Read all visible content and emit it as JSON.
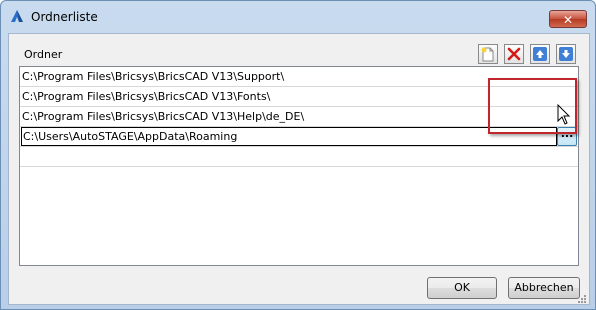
{
  "window": {
    "title": "Ordnerliste",
    "close_label": "✕"
  },
  "list": {
    "header": "Ordner",
    "rows": [
      "C:\\Program Files\\Bricsys\\BricsCAD V13\\Support\\",
      "C:\\Program Files\\Bricsys\\BricsCAD V13\\Fonts\\",
      "C:\\Program Files\\Bricsys\\BricsCAD V13\\Help\\de_DE\\"
    ],
    "edit_value": "C:\\Users\\AutoSTAGE\\AppData\\Roaming",
    "browse_label": "..."
  },
  "toolbar": {
    "icons": [
      "new-folder-icon",
      "delete-icon",
      "move-up-icon",
      "move-down-icon"
    ]
  },
  "buttons": {
    "ok": "OK",
    "cancel": "Abbrechen"
  },
  "colors": {
    "highlight": "#c0272d",
    "titlebar": "#c9dbef"
  }
}
